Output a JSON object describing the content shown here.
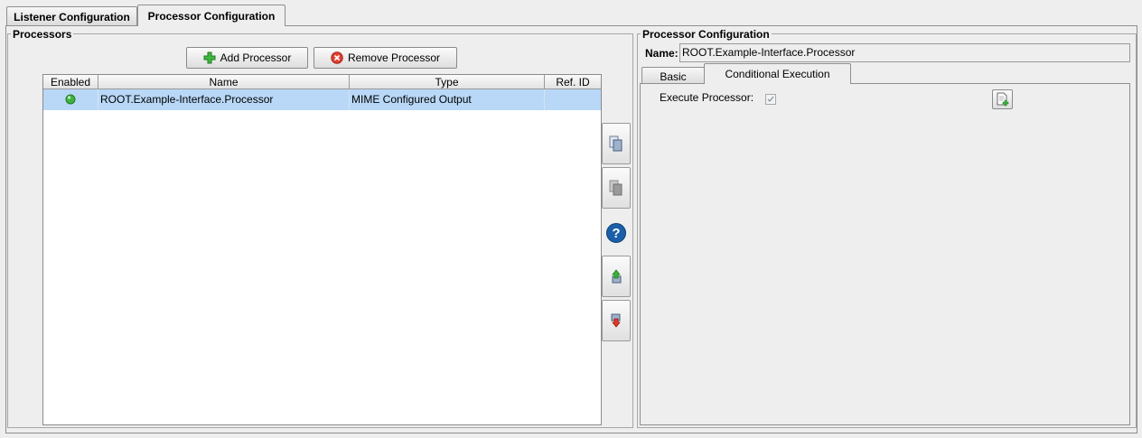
{
  "tabs": [
    {
      "label": "Listener Configuration"
    },
    {
      "label": "Processor Configuration"
    }
  ],
  "processors": {
    "title": "Processors",
    "add_label": "Add Processor",
    "remove_label": "Remove Processor",
    "columns": [
      "Enabled",
      "Name",
      "Type",
      "Ref. ID"
    ],
    "rows": [
      {
        "enabled": true,
        "name": "ROOT.Example-Interface.Processor",
        "type": "MIME Configured Output",
        "ref_id": ""
      }
    ]
  },
  "side_icons": [
    "copy-icon",
    "paste-icon",
    "help-icon",
    "move-up-icon",
    "move-down-icon"
  ],
  "config": {
    "title": "Processor Configuration",
    "name_label": "Name:",
    "name_value": "ROOT.Example-Interface.Processor",
    "subtabs": [
      {
        "label": "Basic"
      },
      {
        "label": "Conditional Execution"
      }
    ],
    "execute_label": "Execute Processor:",
    "execute_checked": true
  },
  "colors": {
    "selection": "#b9d8f7",
    "enabled_dot": "#3cb33c",
    "help": "#1b5fa8"
  }
}
